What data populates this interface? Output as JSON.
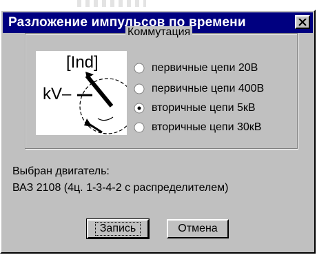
{
  "window": {
    "title": "Разложение импульсов по времени"
  },
  "commutation": {
    "group_label": "Коммутация",
    "illustration": {
      "top_label": "[Ind]",
      "left_label": "kV–"
    },
    "options": [
      {
        "label": "первичные цепи 20В",
        "selected": false
      },
      {
        "label": "первичные цепи 400В",
        "selected": false
      },
      {
        "label": "вторичные цепи 5кВ",
        "selected": true
      },
      {
        "label": "вторичные цепи 30кВ",
        "selected": false
      }
    ]
  },
  "engine": {
    "label": "Выбран двигатель:",
    "value": "ВАЗ 2108 (4ц. 1-3-4-2 с распределителем)"
  },
  "buttons": {
    "save": "Запись",
    "cancel": "Отмена"
  },
  "icons": {
    "close": "close-icon",
    "radio": "radio-icon"
  },
  "colors": {
    "title_bar": "#000080",
    "face": "#c0c0c0"
  }
}
